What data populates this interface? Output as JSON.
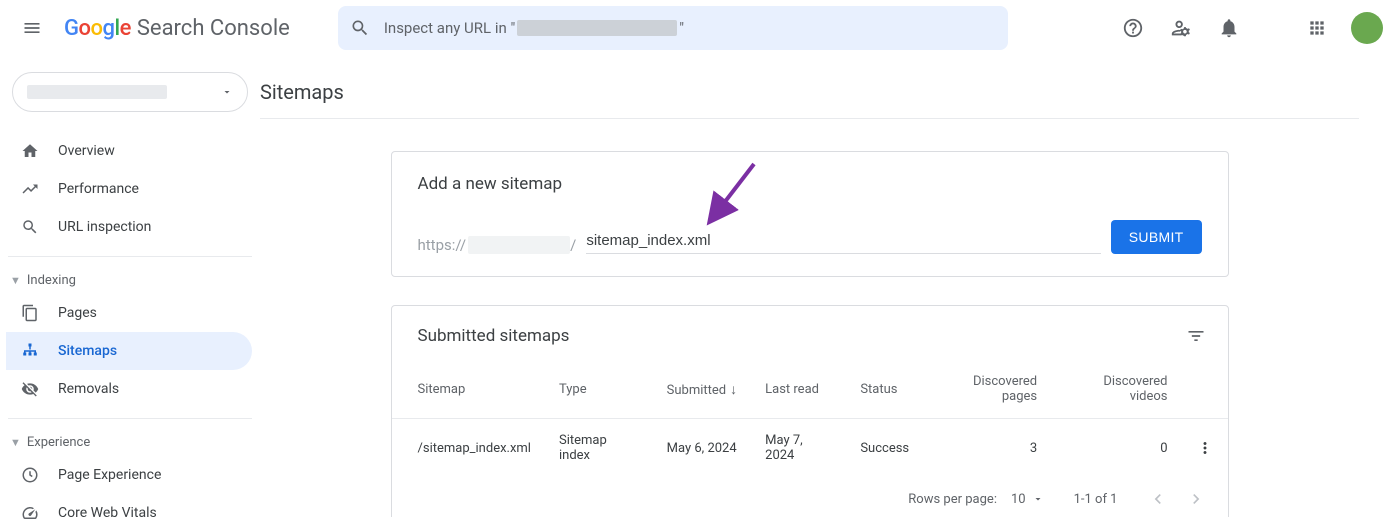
{
  "header": {
    "logo_google": "Google",
    "logo_product": "Search Console",
    "search_prefix": "Inspect any URL in \"",
    "search_suffix": "\""
  },
  "sidebar": {
    "items": [
      {
        "label": "Overview",
        "icon": "home"
      },
      {
        "label": "Performance",
        "icon": "trending"
      },
      {
        "label": "URL inspection",
        "icon": "search"
      }
    ],
    "section_indexing": "Indexing",
    "indexing_items": [
      {
        "label": "Pages",
        "icon": "pages"
      },
      {
        "label": "Sitemaps",
        "icon": "sitemap",
        "active": true
      },
      {
        "label": "Removals",
        "icon": "removals"
      }
    ],
    "section_experience": "Experience",
    "experience_items": [
      {
        "label": "Page Experience",
        "icon": "page-exp"
      },
      {
        "label": "Core Web Vitals",
        "icon": "speed"
      }
    ]
  },
  "main": {
    "title": "Sitemaps",
    "add_card": {
      "title": "Add a new sitemap",
      "url_prefix": "https://",
      "url_slash": "/",
      "input_value": "sitemap_index.xml",
      "submit_label": "SUBMIT"
    },
    "submitted_card": {
      "title": "Submitted sitemaps",
      "columns": {
        "sitemap": "Sitemap",
        "type": "Type",
        "submitted": "Submitted",
        "last_read": "Last read",
        "status": "Status",
        "discovered_pages": "Discovered pages",
        "discovered_videos": "Discovered videos"
      },
      "rows": [
        {
          "sitemap": "/sitemap_index.xml",
          "type": "Sitemap index",
          "submitted": "May 6, 2024",
          "last_read": "May 7, 2024",
          "status": "Success",
          "discovered_pages": "3",
          "discovered_videos": "0"
        }
      ],
      "footer": {
        "rows_per_page_label": "Rows per page:",
        "rows_per_page_value": "10",
        "range": "1-1 of 1"
      }
    }
  }
}
